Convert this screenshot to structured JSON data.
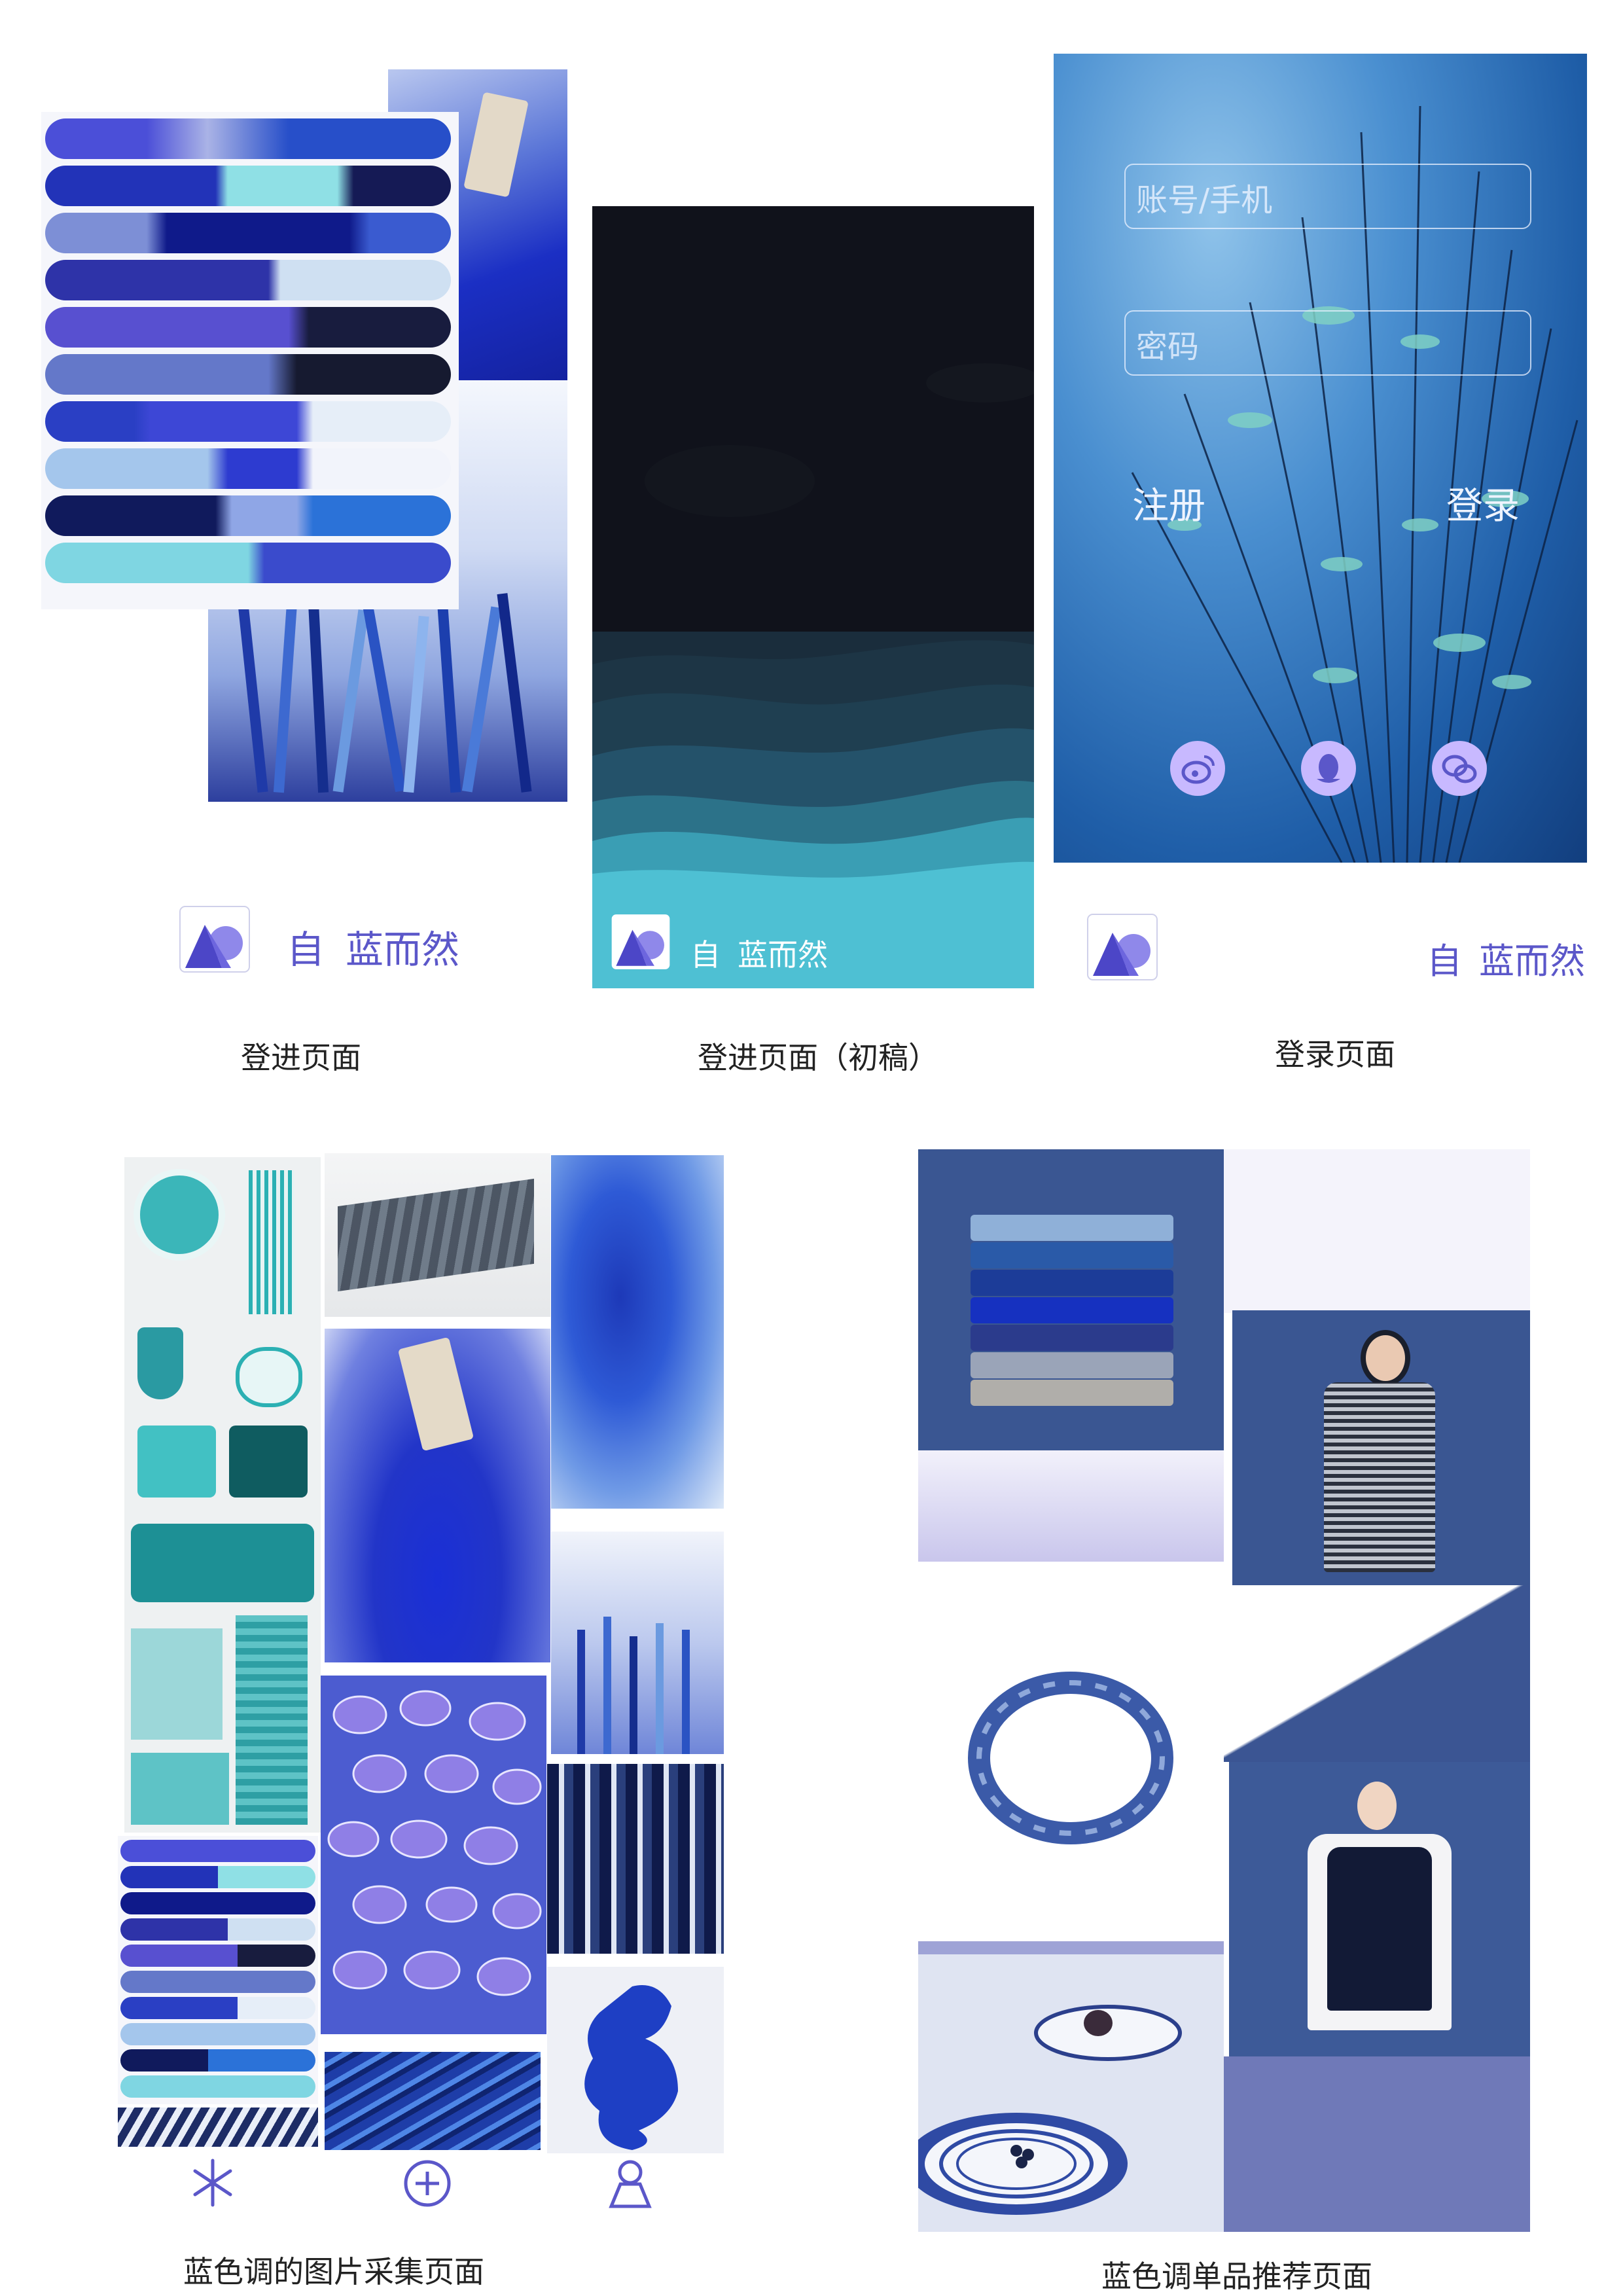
{
  "screens": {
    "splash": {
      "caption": "登进页面",
      "brand": {
        "char": "自",
        "name": "蓝而然"
      }
    },
    "splash_draft": {
      "caption": "登进页面（初稿）",
      "brand": {
        "char": "自",
        "name": "蓝而然"
      }
    },
    "login": {
      "caption": "登录页面",
      "account_placeholder": "账号/手机",
      "password_placeholder": "密码",
      "register_label": "注册",
      "login_label": "登录",
      "social_icons": [
        "weibo-icon",
        "qq-icon",
        "wechat-icon"
      ],
      "brand": {
        "char": "自",
        "name": "蓝而然"
      }
    },
    "collection": {
      "caption": "蓝色调的图片采集页面",
      "nav_icons": [
        "asterisk-icon",
        "plus-circle-icon",
        "user-icon"
      ]
    },
    "recommend": {
      "caption": "蓝色调单品推荐页面"
    }
  },
  "colors": {
    "brand": "#5b57c9",
    "logo_light": "#8f88ea",
    "logo_dark": "#4c46c7",
    "login_bg": "#2d6fb0",
    "night": "#11131c",
    "wave_light": "#4ec0d3"
  }
}
